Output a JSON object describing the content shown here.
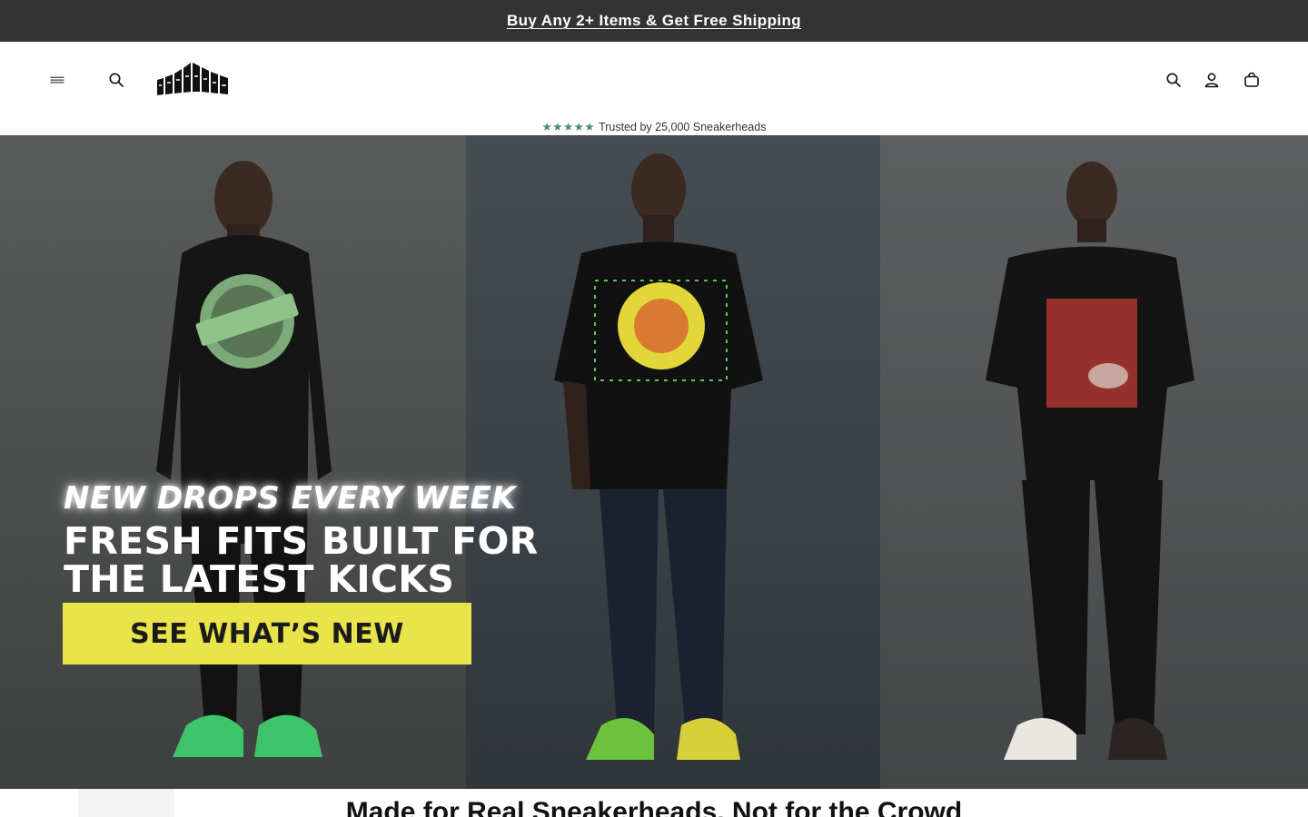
{
  "announcement": {
    "text": "Buy Any 2+ Items & Get Free Shipping"
  },
  "header": {
    "logo_text": "SNKADX",
    "icons": [
      "menu-icon",
      "search-icon",
      "search-icon",
      "account-icon",
      "cart-icon"
    ]
  },
  "trust": {
    "stars": "★★★★★",
    "text": "Trusted by 25,000 Sneakerheads"
  },
  "hero": {
    "kicker": "NEW DROPS EVERY WEEK",
    "headline_line1": "FRESH FITS BUILT FOR",
    "headline_line2": "THE LATEST KICKS",
    "cta_label": "SEE WHAT’S NEW",
    "cta_color": "#e8e44a"
  },
  "section": {
    "title": "Made for Real Sneakerheads, Not for the Crowd"
  },
  "colors": {
    "announcement_bg": "#333333",
    "star_color": "#4a8a6a"
  }
}
